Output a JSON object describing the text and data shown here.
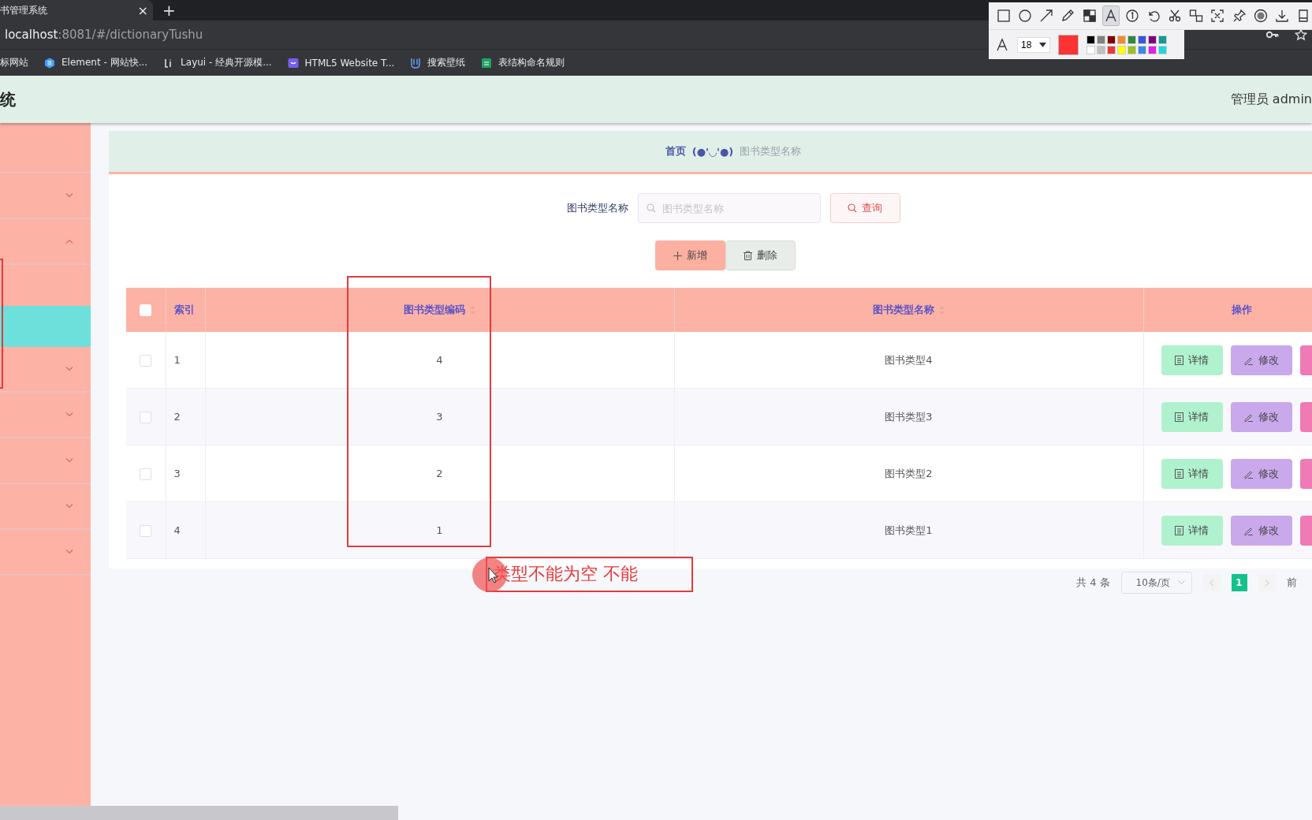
{
  "browser": {
    "tab_title": "书管理系统",
    "new_tab": "+",
    "close_tab": "×",
    "url_host": "localhost",
    "url_rest": ":8081/#/dictionaryTushu",
    "bookmarks": [
      {
        "label": "标网站",
        "kind": "none"
      },
      {
        "label": "Element - 网站快...",
        "kind": "hex"
      },
      {
        "label": "Layui - 经典开源模...",
        "kind": "layui"
      },
      {
        "label": "HTML5 Website T...",
        "kind": "shield"
      },
      {
        "label": "搜索壁纸",
        "kind": "cup"
      },
      {
        "label": "表结构命名规则",
        "kind": "sheet"
      }
    ]
  },
  "annotation_toolbar": {
    "tools": [
      {
        "kind": "rect",
        "selected": false
      },
      {
        "kind": "ellipse",
        "selected": false
      },
      {
        "kind": "arrow",
        "selected": false
      },
      {
        "kind": "pencil",
        "selected": false
      },
      {
        "kind": "mosaic",
        "selected": false
      },
      {
        "kind": "text",
        "selected": true
      },
      {
        "kind": "number",
        "selected": false
      },
      {
        "kind": "undo",
        "selected": false
      },
      {
        "kind": "cut",
        "selected": false
      },
      {
        "kind": "translate",
        "selected": false
      },
      {
        "kind": "ocr",
        "selected": false
      },
      {
        "kind": "pin",
        "selected": false
      },
      {
        "kind": "record",
        "selected": false
      },
      {
        "kind": "download",
        "selected": false
      },
      {
        "kind": "save",
        "selected": false
      }
    ],
    "font_size": "18",
    "palette": [
      {
        "color": "#000000"
      },
      {
        "color": "#808080"
      },
      {
        "color": "#800000"
      },
      {
        "color": "#f08a30"
      },
      {
        "color": "#2e8b3a"
      },
      {
        "color": "#3458d8"
      },
      {
        "color": "#800080"
      },
      {
        "color": "#109a9a"
      },
      {
        "color": "#ffffff"
      },
      {
        "color": "#c0c0c0"
      },
      {
        "color": "#e83a3a"
      },
      {
        "color": "#ffff00"
      },
      {
        "color": "#98c020"
      },
      {
        "color": "#3a88e8"
      },
      {
        "color": "#e020e8"
      },
      {
        "color": "#20d8d8"
      }
    ]
  },
  "header": {
    "title": "统",
    "user": "管理员 admin"
  },
  "sidebar": {
    "items": [
      {
        "kind": "plain"
      },
      {
        "kind": "menu",
        "expanded": false
      },
      {
        "kind": "menu",
        "expanded": true,
        "children": [
          {
            "selected": true
          }
        ]
      },
      {
        "kind": "menu",
        "expanded": false
      },
      {
        "kind": "menu",
        "expanded": false
      },
      {
        "kind": "menu",
        "expanded": false
      },
      {
        "kind": "menu",
        "expanded": false
      },
      {
        "kind": "menu",
        "expanded": false
      }
    ]
  },
  "breadcrumb": {
    "home": "首页",
    "face": "(●'◡'●)",
    "current": "图书类型名称"
  },
  "search": {
    "label": "图书类型名称",
    "placeholder": "图书类型名称",
    "button": "查询"
  },
  "actions": {
    "add": "新增",
    "delete": "删除"
  },
  "table": {
    "select_all": {
      "checked": false
    },
    "columns": [
      {
        "label": "索引",
        "sortable": false
      },
      {
        "label": "图书类型编码",
        "sortable": true
      },
      {
        "label": "图书类型名称",
        "sortable": true
      },
      {
        "label": "操作",
        "sortable": false
      }
    ],
    "rows": [
      {
        "checked": false,
        "index": "1",
        "code": "4",
        "name": "图书类型4",
        "buttons": [
          "详情",
          "修改"
        ]
      },
      {
        "checked": false,
        "index": "2",
        "code": "3",
        "name": "图书类型3",
        "buttons": [
          "详情",
          "修改"
        ]
      },
      {
        "checked": false,
        "index": "3",
        "code": "2",
        "name": "图书类型2",
        "buttons": [
          "详情",
          "修改"
        ]
      },
      {
        "checked": false,
        "index": "4",
        "code": "1",
        "name": "图书类型1",
        "buttons": [
          "详情",
          "修改"
        ]
      }
    ]
  },
  "pagination": {
    "total": "共 4 条",
    "page_size": "10条/页",
    "pages": [
      {
        "label": "1",
        "selected": true
      }
    ],
    "goto": "前"
  },
  "annotations": [
    {
      "kind": "rect"
    },
    {
      "kind": "rect"
    },
    {
      "kind": "rect"
    },
    {
      "kind": "text",
      "text": "类型不能为空 不能"
    },
    {
      "kind": "cursor"
    }
  ]
}
